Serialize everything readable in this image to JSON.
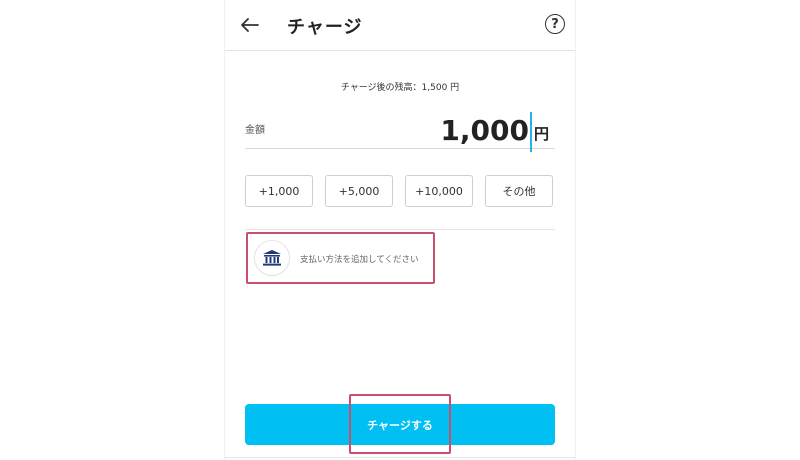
{
  "header": {
    "title": "チャージ",
    "help_label": "?"
  },
  "balance": {
    "text": "チャージ後の残高：1,500 円"
  },
  "amount": {
    "label": "金額",
    "value": "1,000",
    "unit": "円"
  },
  "quick_buttons": [
    {
      "label": "+1,000"
    },
    {
      "label": "+5,000"
    },
    {
      "label": "+10,000"
    },
    {
      "label": "その他"
    }
  ],
  "payment": {
    "label": "支払い方法を追加してください",
    "icon": "bank-icon"
  },
  "charge_button": {
    "label": "チャージする"
  },
  "colors": {
    "accent": "#00bff3",
    "highlight": "#c94f6d",
    "caret": "#27b3e8",
    "bank_icon": "#1f3a78"
  }
}
